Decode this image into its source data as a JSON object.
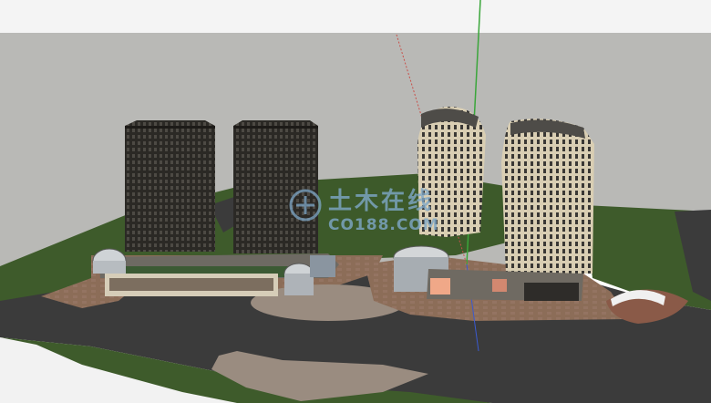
{
  "scene": {
    "title": "",
    "description_visible_text": []
  },
  "watermark": {
    "chinese": "土木在线",
    "latin": "CO188.COM",
    "color": "#7fa8c8"
  },
  "colors": {
    "sky": "#f4f4f4",
    "horizon_band": "#b9b9b6",
    "lawn": "#3d5a2a",
    "road": "#3b3b3b",
    "plaza": "#8a6a55",
    "tower_dark": "#2c2a26",
    "tower_cream": "#d8ccb0",
    "axis_green": "#3aa63a",
    "axis_red": "#c8504a"
  }
}
